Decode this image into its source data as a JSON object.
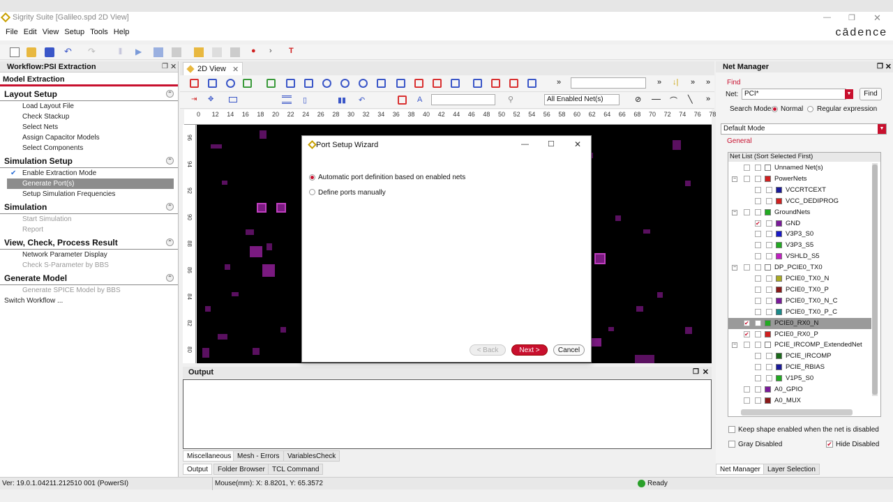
{
  "window": {
    "title": "Sigrity Suite [Galileo.spd 2D View]",
    "brand": "cādence"
  },
  "menu": [
    "File",
    "Edit",
    "View",
    "Setup",
    "Tools",
    "Help"
  ],
  "left": {
    "header": "Workflow:PSI Extraction",
    "subheader": "Model Extraction",
    "sections": [
      {
        "title": "Layout Setup",
        "items": [
          {
            "label": "Load Layout File"
          },
          {
            "label": "Check Stackup"
          },
          {
            "label": "Select Nets"
          },
          {
            "label": "Assign Capacitor Models"
          },
          {
            "label": "Select Components"
          }
        ]
      },
      {
        "title": "Simulation Setup",
        "items": [
          {
            "label": "Enable Extraction Mode",
            "checked": true
          },
          {
            "label": "Generate Port(s)",
            "selected": true
          },
          {
            "label": "Setup Simulation Frequencies"
          }
        ]
      },
      {
        "title": "Simulation",
        "items": [
          {
            "label": "Start Simulation",
            "disabled": true
          },
          {
            "label": "Report",
            "disabled": true
          }
        ]
      },
      {
        "title": "View, Check, Process Result",
        "items": [
          {
            "label": "Network Parameter Display"
          },
          {
            "label": "Check S-Parameter by BBS",
            "disabled": true
          }
        ]
      },
      {
        "title": "Generate Model",
        "items": [
          {
            "label": "Generate SPICE Model by BBS",
            "disabled": true
          }
        ]
      }
    ],
    "switch_workflow": "Switch Workflow ..."
  },
  "center": {
    "tab": "2D View",
    "net_filter": "All Enabled Net(s)",
    "ruler": [
      "0",
      "12",
      "14",
      "16",
      "18",
      "20",
      "22",
      "24",
      "26",
      "28",
      "30",
      "32",
      "34",
      "36",
      "38",
      "40",
      "42",
      "44",
      "46",
      "48",
      "50",
      "52",
      "54",
      "56",
      "58",
      "60",
      "62",
      "64",
      "66",
      "68",
      "70",
      "72",
      "74",
      "76",
      "78"
    ],
    "vruler": [
      "96",
      "94",
      "92",
      "90",
      "88",
      "86",
      "84",
      "82",
      "80"
    ]
  },
  "dialog": {
    "title": "Port Setup Wizard",
    "option_auto": "Automatic port definition based on enabled nets",
    "option_manual": "Define ports manually",
    "back": "< Back",
    "next": "Next >",
    "cancel": "Cancel"
  },
  "output": {
    "title": "Output",
    "tabs1": [
      "Miscellaneous",
      "Mesh - Errors",
      "VariablesCheck"
    ],
    "tabs2": [
      "Output",
      "Folder Browser",
      "TCL Command"
    ]
  },
  "right": {
    "header": "Net Manager",
    "find_label": "Find",
    "net_label": "Net:",
    "net_value": "PCI*",
    "find_button": "Find",
    "search_mode_label": "Search Mode:",
    "mode_normal": "Normal",
    "mode_regex": "Regular expression",
    "mode_select": "Default Mode",
    "general_label": "General",
    "list_header": "Net List (Sort Selected First)",
    "nets": [
      {
        "name": "Unnamed Net(s)",
        "level": 0,
        "color": "#ffffff"
      },
      {
        "name": "PowerNets",
        "level": 0,
        "group": true,
        "color": "#d02020"
      },
      {
        "name": "VCCRTCEXT",
        "level": 1,
        "color": "#1a1a9a"
      },
      {
        "name": "VCC_DEDIPROG",
        "level": 1,
        "color": "#d02020"
      },
      {
        "name": "GroundNets",
        "level": 0,
        "group": true,
        "color": "#22aa22"
      },
      {
        "name": "GND",
        "level": 1,
        "color": "#7a1a9a",
        "checked": true
      },
      {
        "name": "V3P3_S0",
        "level": 1,
        "color": "#1a1ac8"
      },
      {
        "name": "V3P3_S5",
        "level": 1,
        "color": "#22aa22"
      },
      {
        "name": "VSHLD_S5",
        "level": 1,
        "color": "#c020c0"
      },
      {
        "name": "DP_PCIE0_TX0",
        "level": 0,
        "group": true,
        "color": "#ffffff"
      },
      {
        "name": "PCIE0_TX0_N",
        "level": 1,
        "color": "#aaaa22"
      },
      {
        "name": "PCIE0_TX0_P",
        "level": 1,
        "color": "#8a1a1a"
      },
      {
        "name": "PCIE0_TX0_N_C",
        "level": 1,
        "color": "#7a1a9a"
      },
      {
        "name": "PCIE0_TX0_P_C",
        "level": 1,
        "color": "#1a8a8a"
      },
      {
        "name": "PCIE0_RX0_N",
        "level": 0,
        "color": "#22aa22",
        "checked": true,
        "highlight": true
      },
      {
        "name": "PCIE0_RX0_P",
        "level": 0,
        "color": "#d02020",
        "checked": true
      },
      {
        "name": "PCIE_IRCOMP_ExtendedNet",
        "level": 0,
        "group": true,
        "color": "#ffffff"
      },
      {
        "name": "PCIE_IRCOMP",
        "level": 1,
        "color": "#1a6a1a"
      },
      {
        "name": "PCIE_RBIAS",
        "level": 1,
        "color": "#1a1a9a"
      },
      {
        "name": "V1P5_S0",
        "level": 1,
        "color": "#22aa22"
      },
      {
        "name": "A0_GPIO",
        "level": 0,
        "color": "#7a1a9a"
      },
      {
        "name": "A0_MUX",
        "level": 0,
        "color": "#8a1a1a"
      }
    ],
    "keep_shape": "Keep shape enabled when the net is disabled",
    "gray_disabled": "Gray Disabled",
    "hide_disabled": "Hide Disabled",
    "bottom_tabs": [
      "Net Manager",
      "Layer Selection"
    ]
  },
  "status": {
    "version": "Ver: 19.0.1.04211.212510 001 (PowerSI)",
    "mouse": "Mouse(mm): X: 8.8201, Y: 65.3572",
    "ready": "Ready"
  }
}
